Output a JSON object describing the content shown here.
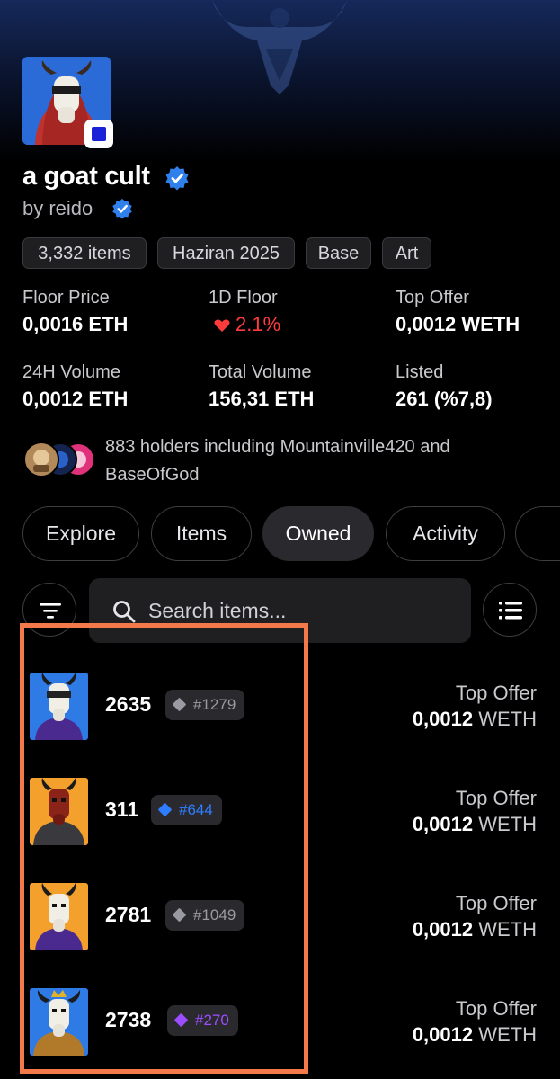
{
  "collection": {
    "name": "a goat cult",
    "creator": "by reido",
    "tags": [
      "3,332 items",
      "Haziran 2025",
      "Base",
      "Art"
    ]
  },
  "stats": {
    "floor_price": {
      "label": "Floor Price",
      "value": "0,0016 ETH"
    },
    "one_day_floor": {
      "label": "1D Floor",
      "value": "2.1%"
    },
    "top_offer": {
      "label": "Top Offer",
      "value": "0,0012 WETH"
    },
    "volume_24h": {
      "label": "24H Volume",
      "value": "0,0012 ETH"
    },
    "total_volume": {
      "label": "Total Volume",
      "value": "156,31 ETH"
    },
    "listed": {
      "label": "Listed",
      "value": "261 (%7,8)"
    }
  },
  "holders": {
    "text": "883 holders including Mountainville420 and BaseOfGod"
  },
  "tabs": [
    "Explore",
    "Items",
    "Owned",
    "Activity"
  ],
  "active_tab": "Owned",
  "search": {
    "placeholder": "Search items..."
  },
  "items": [
    {
      "name": "2635",
      "rank": "#1279",
      "rank_color": "#9a9aa2",
      "offer_label": "Top Offer",
      "offer_amount": "0,0012",
      "offer_currency": "WETH",
      "bg_color": "#2f7be6",
      "character": "white-goat-blindfold"
    },
    {
      "name": "311",
      "rank": "#644",
      "rank_color": "#2f7dff",
      "offer_label": "Top Offer",
      "offer_amount": "0,0012",
      "offer_currency": "WETH",
      "bg_color": "#f4a02c",
      "character": "red-goat-armor"
    },
    {
      "name": "2781",
      "rank": "#1049",
      "rank_color": "#9a9aa2",
      "offer_label": "Top Offer",
      "offer_amount": "0,0012",
      "offer_currency": "WETH",
      "bg_color": "#f4a02c",
      "character": "white-goat-hoodie"
    },
    {
      "name": "2738",
      "rank": "#270",
      "rank_color": "#9b4dff",
      "offer_label": "Top Offer",
      "offer_amount": "0,0012",
      "offer_currency": "WETH",
      "bg_color": "#2f7be6",
      "character": "white-goat-crown"
    }
  ],
  "colors": {
    "accent_verified": "#2f80ed",
    "negative": "#ff3b3b",
    "highlight": "#f4794a"
  }
}
